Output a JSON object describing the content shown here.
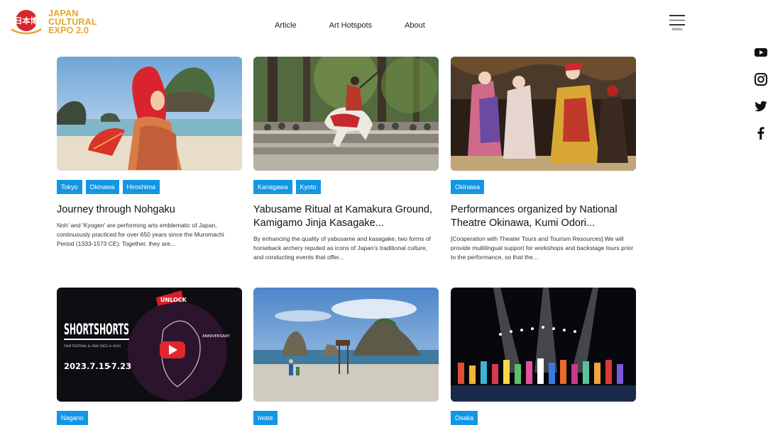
{
  "header": {
    "logo_lines": [
      "JAPAN",
      "CULTURAL",
      "EXPO 2.0"
    ],
    "logo_mark_text": "日本博",
    "nav": [
      "Article",
      "Art Hotspots",
      "About"
    ],
    "menu_label": "menu"
  },
  "social": [
    "youtube-icon",
    "instagram-icon",
    "twitter-icon",
    "facebook-icon"
  ],
  "cards": [
    {
      "tags": [
        "Tokyo",
        "Okinawa",
        "Hiroshima"
      ],
      "title": "Journey through Nohgaku",
      "desc": "Noh' and 'Kyogen' are performing arts emblematic of Japan, continuously practiced for over 650 years since the Muromachi Period (1333-1573 CE). Together, they are..."
    },
    {
      "tags": [
        "Kanagawa",
        "Kyoto"
      ],
      "title": "Yabusame Ritual at Kamakura Ground, Kamigamo Jinja Kasagake...",
      "desc": "By enhancing the quality of yabusame and kasagake, two forms of horseback archery reputed as icons of Japan's traditional culture, and conducting events that offer..."
    },
    {
      "tags": [
        "Okinawa"
      ],
      "title": "Performances organized by National Theatre Okinawa, Kumi Odori...",
      "desc": "[Cooperation with Theater Tours and Tourism Resources] We will provide multilingual support for workshops and backstage tours prior to the performance, so that the..."
    },
    {
      "tags": [
        "Nagano"
      ],
      "title": "",
      "desc": ""
    },
    {
      "tags": [
        "Iwate"
      ],
      "title": "",
      "desc": ""
    },
    {
      "tags": [
        "Osaka"
      ],
      "title": "",
      "desc": ""
    }
  ],
  "poster": {
    "title": "SHORTSHORTS",
    "line1": "FILM FESTIVAL & ASIA 2023 in ACHI",
    "dates": "2023.7.15",
    "dates2": "-7.23",
    "badge": "ANNIVERSARY",
    "unlock": "UNLOCK"
  },
  "colors": {
    "tag": "#1296e6",
    "logo": "#e3a72b",
    "logo_red": "#d7262e"
  }
}
